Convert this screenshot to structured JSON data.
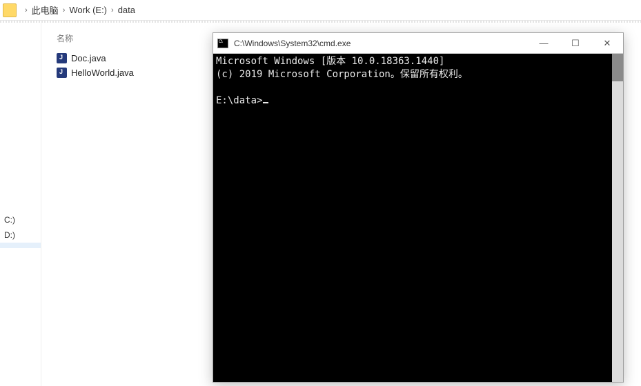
{
  "explorer": {
    "breadcrumb": {
      "root": "此电脑",
      "drive": "Work (E:)",
      "folder": "data"
    },
    "column_header": "名称",
    "files": [
      {
        "name": "Doc.java"
      },
      {
        "name": "HelloWorld.java"
      }
    ],
    "drives": [
      {
        "label": "C:)"
      },
      {
        "label": "D:)"
      }
    ]
  },
  "cmd": {
    "title": "C:\\Windows\\System32\\cmd.exe",
    "line1": "Microsoft Windows [版本 10.0.18363.1440]",
    "line2": "(c) 2019 Microsoft Corporation。保留所有权利。",
    "prompt": "E:\\data>",
    "buttons": {
      "min": "—",
      "max": "☐",
      "close": "✕"
    }
  }
}
